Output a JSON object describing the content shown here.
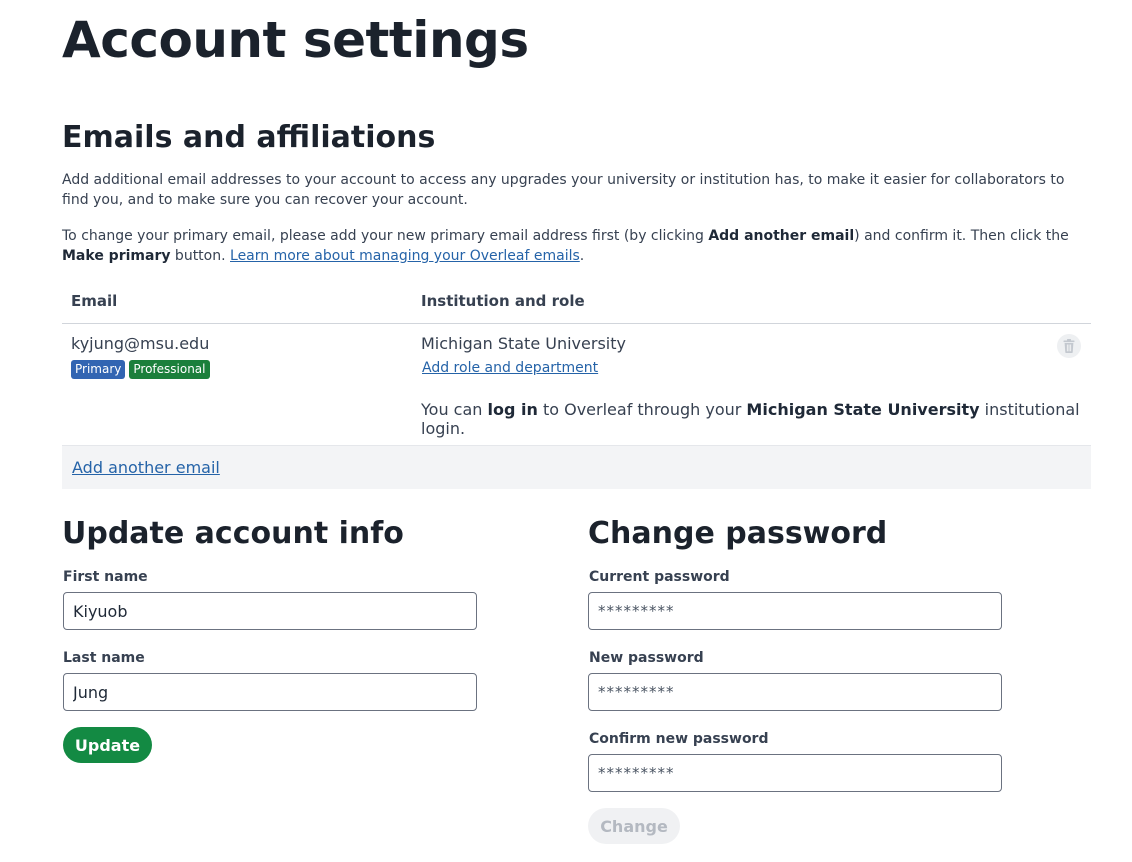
{
  "page_title": "Account settings",
  "emails_section": {
    "title": "Emails and affiliations",
    "intro": "Add additional email addresses to your account to access any upgrades your university or institution has, to make it easier for collaborators to find you, and to make sure you can recover your account.",
    "primary_note_1": "To change your primary email, please add your new primary email address first (by clicking ",
    "primary_note_bold_1": "Add another email",
    "primary_note_2": ") and confirm it. Then click the ",
    "primary_note_bold_2": "Make primary",
    "primary_note_3": " button. ",
    "learn_more_link": "Learn more about managing your Overleaf emails",
    "primary_note_end": ".",
    "table": {
      "col_email": "Email",
      "col_institution": "Institution and role",
      "rows": [
        {
          "email": "kyjung@msu.edu",
          "badge_primary": "Primary",
          "badge_professional": "Professional",
          "institution": "Michigan State University",
          "role_link": "Add role and department",
          "sso_1": "You can ",
          "sso_bold_1": "log in",
          "sso_2": " to Overleaf through your ",
          "sso_bold_2": "Michigan State University",
          "sso_3": " institutional login."
        }
      ]
    },
    "add_email_link": "Add another email"
  },
  "account_info": {
    "title": "Update account info",
    "first_name_label": "First name",
    "first_name_value": "Kiyuob",
    "last_name_label": "Last name",
    "last_name_value": "Jung",
    "update_button": "Update"
  },
  "change_password": {
    "title": "Change password",
    "current_label": "Current password",
    "current_value": "*********",
    "new_label": "New password",
    "new_value": "*********",
    "confirm_label": "Confirm new password",
    "confirm_value": "*********",
    "change_button": "Change"
  },
  "colors": {
    "badge_primary": "#3265b2",
    "badge_professional": "#1b7f3b",
    "update_button": "#138a43",
    "link": "#2563a8"
  }
}
